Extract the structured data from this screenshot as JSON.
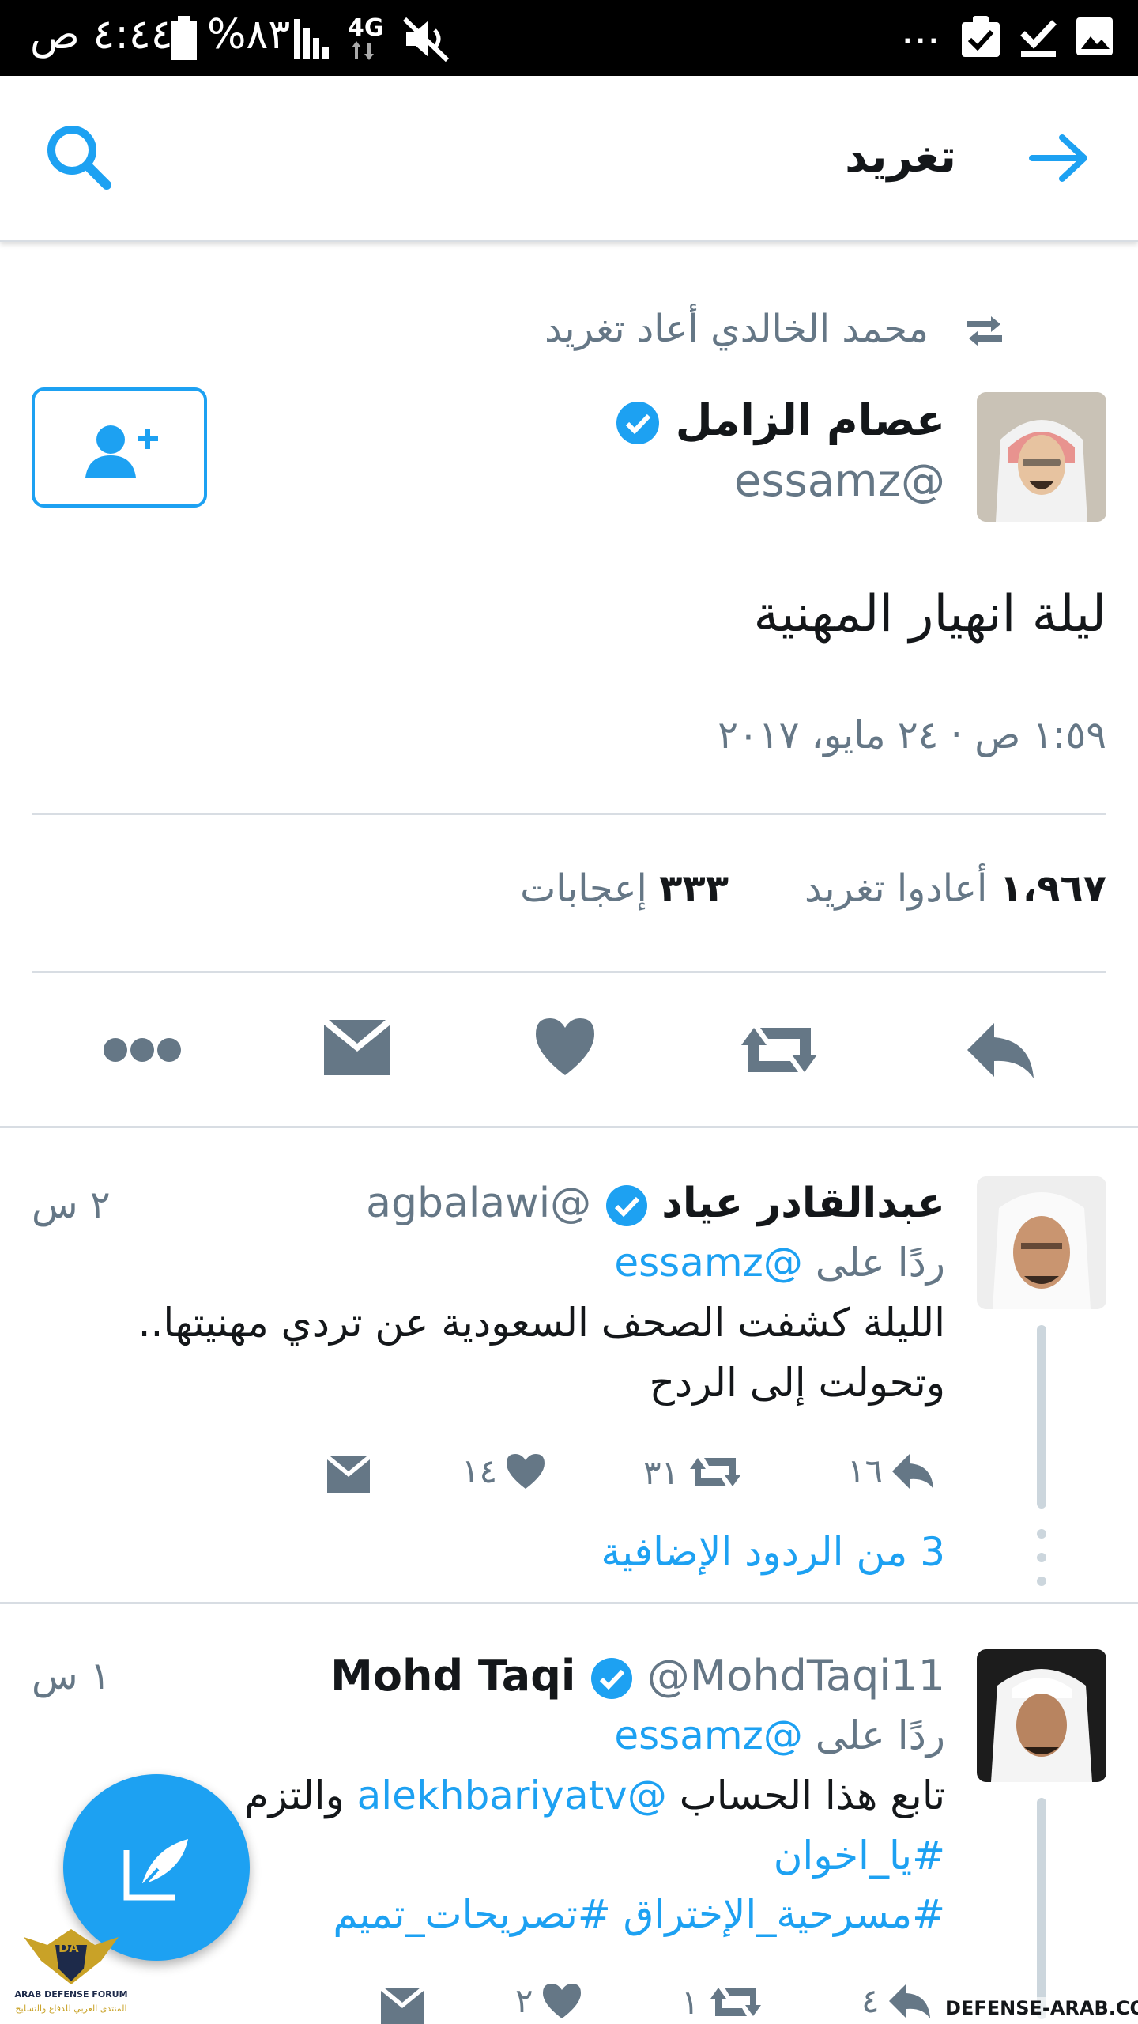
{
  "status_bar": {
    "time": "٤:٤٤ ص",
    "battery": "%٨٣",
    "network": "4G",
    "overflow": "..."
  },
  "app_bar": {
    "title": "تغريد"
  },
  "tweet": {
    "retweeted_by": "محمد الخالدي أعاد تغريد",
    "author_name": "عصام الزامل",
    "author_handle": "@essamz",
    "text": "ليلة انهيار المهنية",
    "timestamp": "١:٥٩ ص · ٢٤ مايو، ٢٠١٧",
    "retweets_count": "١،٩٦٧",
    "retweets_label": "أعادوا تغريد",
    "likes_count": "٣٣٣",
    "likes_label": "إعجابات"
  },
  "replies": [
    {
      "author_name": "عبدالقادر عياد",
      "author_handle": "@agbalawi",
      "time": "٢ س",
      "reply_to_prefix": "ردًا على",
      "reply_to": "@essamz",
      "text_line1": "الليلة كشفت الصحف السعودية عن تردي مهنيتها..",
      "text_line2": "وتحولت إلى الردح",
      "replies": "١٦",
      "retweets": "٣١",
      "likes": "١٤",
      "more_replies": "3 من الردود الإضافية"
    },
    {
      "author_name": "Mohd Taqi",
      "author_handle": "@MohdTaqi11",
      "time": "١ س",
      "reply_to_prefix": "ردًا على",
      "reply_to": "@essamz",
      "text_prefix": "تابع هذا الحساب",
      "text_mention": "@alekhbariyatv",
      "text_suffix": "والتزم",
      "hashtag1": "#يا_اخوان",
      "hashtag2": "#مسرحية_الإختراق #تصريحات_تميم",
      "replies": "٤",
      "retweets": "١",
      "likes": "٢"
    }
  ],
  "watermark": {
    "site": "DEFENSE-ARAB.COM",
    "logo_text": "ARAB DEFENSE FORUM",
    "logo_subtext": "المنتدى العربي للدفاع والتسليح",
    "logo_mark": "DA"
  },
  "colors": {
    "accent": "#1da1f2",
    "muted": "#657786",
    "icon_gray": "#657786"
  }
}
